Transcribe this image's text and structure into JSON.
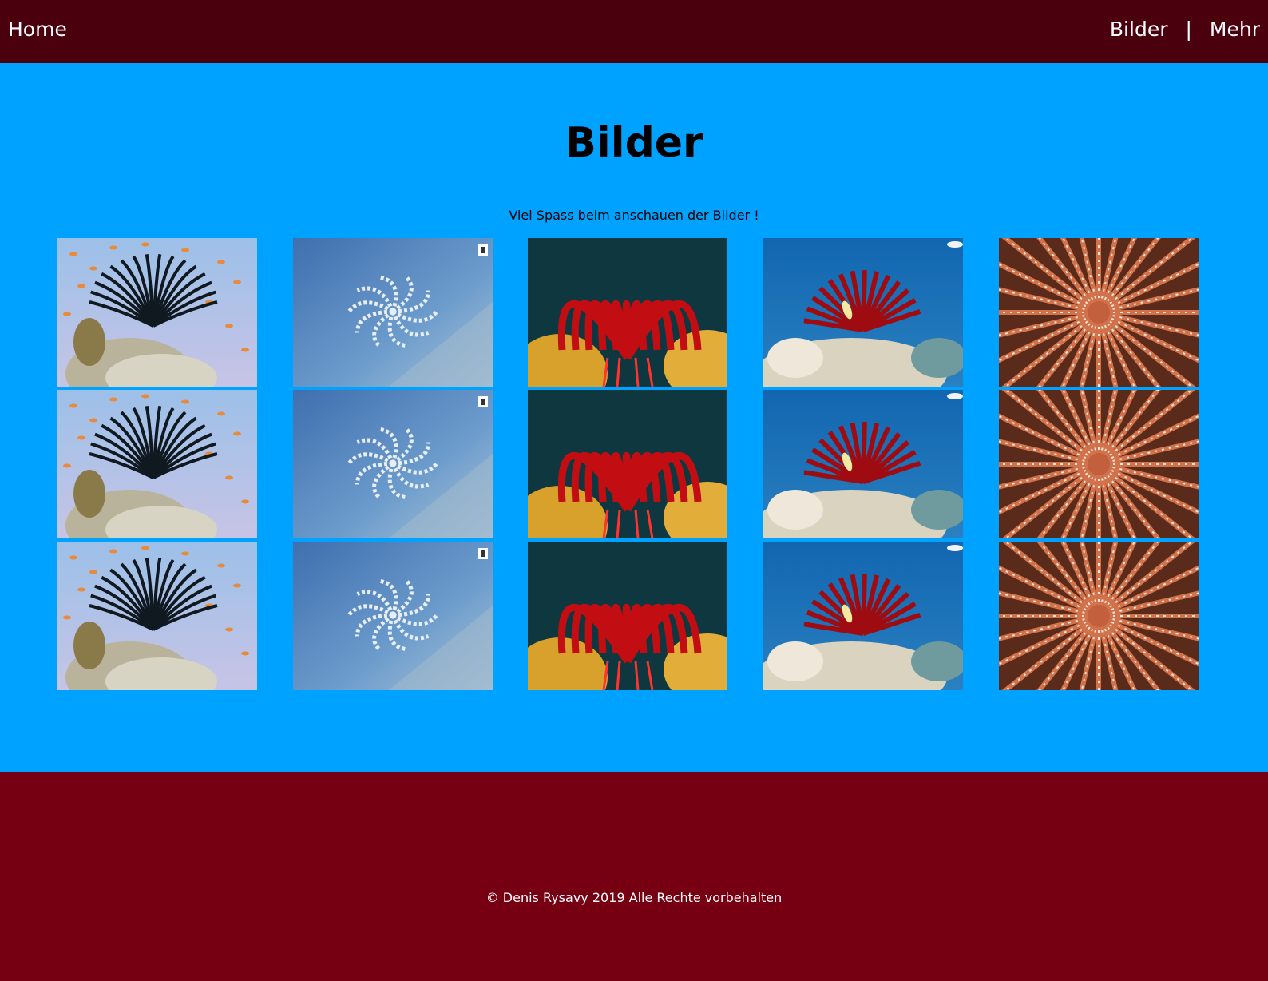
{
  "nav": {
    "home": "Home",
    "bilder": "Bilder",
    "separator": "|",
    "mehr": "Mehr"
  },
  "main": {
    "title": "Bilder",
    "subtitle": "Viel Spass beim anschauen der Bilder !"
  },
  "gallery": {
    "rows": 3,
    "columns": [
      {
        "name": "black-feather-star-icon"
      },
      {
        "name": "white-feather-star-icon"
      },
      {
        "name": "red-feather-star-icon"
      },
      {
        "name": "red-crinoid-reef-icon"
      },
      {
        "name": "fan-worm-icon"
      }
    ]
  },
  "footer": {
    "copyright": "© Denis Rysavy 2019 Alle Rechte vorbehalten"
  },
  "colors": {
    "header": "#4b000e",
    "main": "#00a2ff",
    "footer": "#760012"
  }
}
